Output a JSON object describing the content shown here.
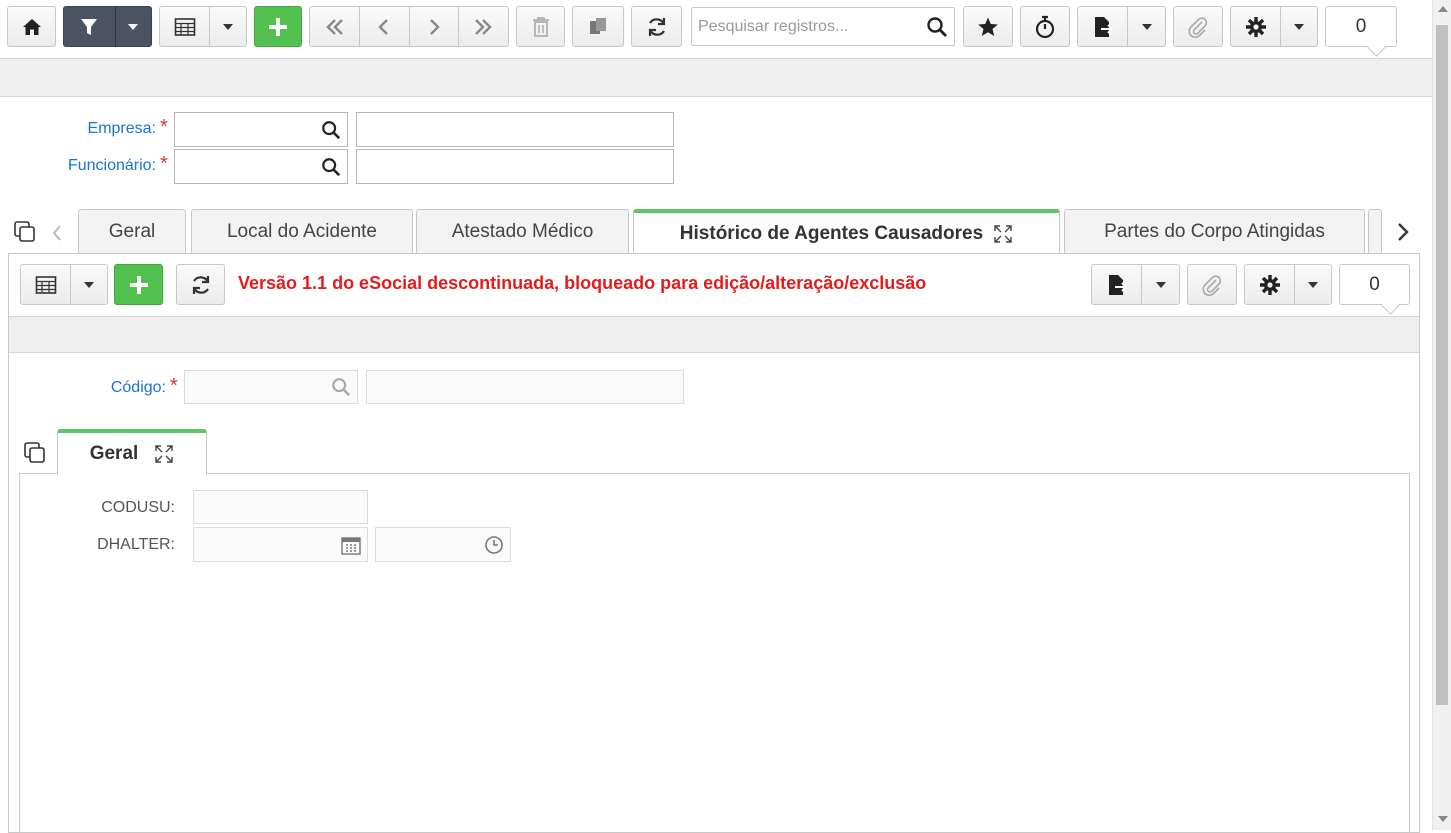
{
  "toolbar": {
    "search_placeholder": "Pesquisar registros...",
    "counter": "0"
  },
  "header_form": {
    "empresa_label": "Empresa:",
    "funcionario_label": "Funcionário:",
    "required_mark": "*"
  },
  "tabs": [
    {
      "label": "Geral"
    },
    {
      "label": "Local do Acidente"
    },
    {
      "label": "Atestado Médico"
    },
    {
      "label": "Histórico de Agentes Causadores"
    },
    {
      "label": "Partes do Corpo Atingidas"
    }
  ],
  "detail": {
    "message": "Versão 1.1 do eSocial descontinuada, bloqueado para edição/alteração/exclusão",
    "counter": "0",
    "codigo_label": "Código:",
    "subtab_label": "Geral",
    "codusu_label": "CODUSU:",
    "dhalter_label": "DHALTER:"
  },
  "colors": {
    "accent_green": "#52c150",
    "active_tab_border": "#5dc765",
    "label_blue": "#1a73d9",
    "warning_red": "#e61c1c",
    "toolbar_dark": "#4a5361"
  }
}
